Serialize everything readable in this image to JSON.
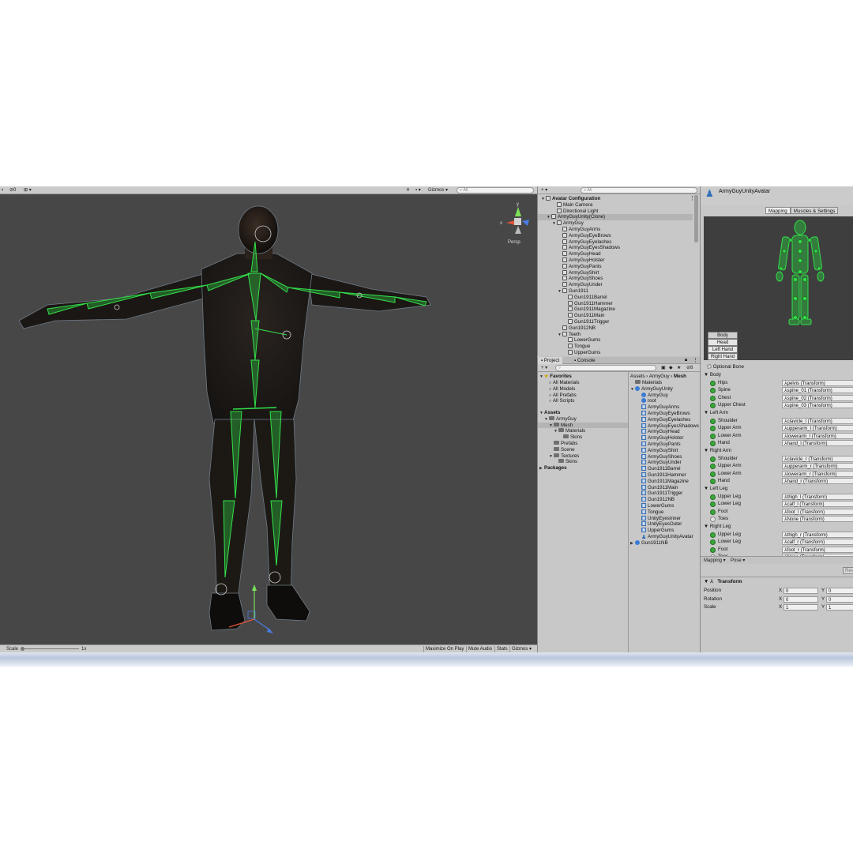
{
  "scene": {
    "toolbar": {
      "stats_left": "0",
      "gizmos": "Gizmos",
      "search_placeholder": "All"
    },
    "persp": "Persp",
    "axis_x": "x",
    "axis_y": "y",
    "gamebar": {
      "scale_label": "Scale",
      "scale_value": "1x",
      "maximize": "Maximize On Play",
      "mute": "Mute Audio",
      "stats": "Stats",
      "gizmos": "Gizmos"
    }
  },
  "hierarchy": {
    "search_placeholder": "All",
    "rows": [
      {
        "label": "Avatar Configuration",
        "indent": 0,
        "arrow": "▼",
        "bold": true
      },
      {
        "label": "Main Camera",
        "indent": 2,
        "arrow": ""
      },
      {
        "label": "Directional Light",
        "indent": 2,
        "arrow": ""
      },
      {
        "label": "ArmyGuyUnity(Clone)",
        "indent": 1,
        "arrow": "▼",
        "selected": true
      },
      {
        "label": "ArmyGuy",
        "indent": 2,
        "arrow": "▼"
      },
      {
        "label": "ArmyGuyArms",
        "indent": 3,
        "arrow": ""
      },
      {
        "label": "ArmyGuyEyeBrows",
        "indent": 3,
        "arrow": ""
      },
      {
        "label": "ArmyGuyEyelashes",
        "indent": 3,
        "arrow": ""
      },
      {
        "label": "ArmyGuyEyesShadows",
        "indent": 3,
        "arrow": ""
      },
      {
        "label": "ArmyGuyHead",
        "indent": 3,
        "arrow": ""
      },
      {
        "label": "ArmyGuyHolster",
        "indent": 3,
        "arrow": ""
      },
      {
        "label": "ArmyGuyPants",
        "indent": 3,
        "arrow": ""
      },
      {
        "label": "ArmyGuyShirt",
        "indent": 3,
        "arrow": ""
      },
      {
        "label": "ArmyGuyShoes",
        "indent": 3,
        "arrow": ""
      },
      {
        "label": "ArmyGuyUnder",
        "indent": 3,
        "arrow": ""
      },
      {
        "label": "Gun1911",
        "indent": 3,
        "arrow": "▼"
      },
      {
        "label": "Gun1911Barrel",
        "indent": 4,
        "arrow": ""
      },
      {
        "label": "Gun1911Hammer",
        "indent": 4,
        "arrow": ""
      },
      {
        "label": "Gun1911Magazine",
        "indent": 4,
        "arrow": ""
      },
      {
        "label": "Gun1911Main",
        "indent": 4,
        "arrow": ""
      },
      {
        "label": "Gun1911Trigger",
        "indent": 4,
        "arrow": ""
      },
      {
        "label": "Gun1912NB",
        "indent": 3,
        "arrow": ""
      },
      {
        "label": "Teeth",
        "indent": 3,
        "arrow": "▼"
      },
      {
        "label": "LowerGums",
        "indent": 4,
        "arrow": ""
      },
      {
        "label": "Tongue",
        "indent": 4,
        "arrow": ""
      },
      {
        "label": "UpperGums",
        "indent": 4,
        "arrow": ""
      }
    ]
  },
  "project": {
    "tab_project": "Project",
    "tab_console": "Console",
    "badge": "8",
    "favorites": "Favorites",
    "fav_items": [
      "All Materials",
      "All Models",
      "All Prefabs",
      "All Scripts"
    ],
    "assets_tree": [
      {
        "label": "Assets",
        "indent": 0,
        "bold": true,
        "arrow": "▼"
      },
      {
        "label": "ArmyGuy",
        "indent": 1,
        "arrow": "▼"
      },
      {
        "label": "Mesh",
        "indent": 2,
        "arrow": "▼",
        "selected": true
      },
      {
        "label": "Materials",
        "indent": 3,
        "arrow": "▼"
      },
      {
        "label": "Skins",
        "indent": 4,
        "arrow": ""
      },
      {
        "label": "Prefabs",
        "indent": 2,
        "arrow": ""
      },
      {
        "label": "Scene",
        "indent": 2,
        "arrow": ""
      },
      {
        "label": "Textures",
        "indent": 2,
        "arrow": "▼"
      },
      {
        "label": "Skins",
        "indent": 3,
        "arrow": ""
      },
      {
        "label": "Packages",
        "indent": 0,
        "bold": true,
        "arrow": "▶"
      }
    ],
    "breadcrumb": [
      "Assets",
      "ArmyGuy",
      "Mesh"
    ],
    "files": [
      {
        "label": "Materials",
        "icon": "folder",
        "indent": 0
      },
      {
        "label": "ArmyGuyUnity",
        "icon": "globe",
        "indent": 0,
        "arrow": "▼"
      },
      {
        "label": "ArmyGuy",
        "icon": "globe",
        "indent": 1
      },
      {
        "label": "root",
        "icon": "globe",
        "indent": 1
      },
      {
        "label": "ArmyGuyArms",
        "icon": "mesh",
        "indent": 1
      },
      {
        "label": "ArmyGuyEyeBrows",
        "icon": "mesh",
        "indent": 1
      },
      {
        "label": "ArmyGuyEyelashes",
        "icon": "mesh",
        "indent": 1
      },
      {
        "label": "ArmyGuyEyesShadows",
        "icon": "mesh",
        "indent": 1
      },
      {
        "label": "ArmyGuyHead",
        "icon": "mesh",
        "indent": 1
      },
      {
        "label": "ArmyGuyHolster",
        "icon": "mesh",
        "indent": 1
      },
      {
        "label": "ArmyGuyPants",
        "icon": "mesh",
        "indent": 1
      },
      {
        "label": "ArmyGuyShirt",
        "icon": "mesh",
        "indent": 1
      },
      {
        "label": "ArmyGuyShoes",
        "icon": "mesh",
        "indent": 1
      },
      {
        "label": "ArmyGuyUnder",
        "icon": "mesh",
        "indent": 1
      },
      {
        "label": "Gun1911Barrel",
        "icon": "mesh",
        "indent": 1
      },
      {
        "label": "Gun1911Hammer",
        "icon": "mesh",
        "indent": 1
      },
      {
        "label": "Gun1911Magazine",
        "icon": "mesh",
        "indent": 1
      },
      {
        "label": "Gun1911Main",
        "icon": "mesh",
        "indent": 1
      },
      {
        "label": "Gun1911Trigger",
        "icon": "mesh",
        "indent": 1
      },
      {
        "label": "Gun1912NB",
        "icon": "mesh",
        "indent": 1
      },
      {
        "label": "LowerGums",
        "icon": "mesh",
        "indent": 1
      },
      {
        "label": "Tongue",
        "icon": "mesh",
        "indent": 1
      },
      {
        "label": "UnityEyesInner",
        "icon": "mesh",
        "indent": 1
      },
      {
        "label": "UnityEyesOuter",
        "icon": "mesh",
        "indent": 1
      },
      {
        "label": "UpperGums",
        "icon": "mesh",
        "indent": 1
      },
      {
        "label": "ArmyGuyUnityAvatar",
        "icon": "avatar",
        "indent": 1
      },
      {
        "label": "Gun1911NB",
        "icon": "globe",
        "indent": 0,
        "arrow": "▶"
      }
    ]
  },
  "inspector": {
    "title": "ArmyGuyUnityAvatar",
    "tab_mapping": "Mapping",
    "tab_muscles": "Muscles & Settings",
    "preview_buttons": [
      "Body",
      "Head",
      "Left Hand",
      "Right Hand"
    ],
    "optional_bone": "Optional Bone",
    "groups": [
      {
        "title": "Body",
        "bones": [
          {
            "label": "Hips",
            "value": "pelvis (Transform)",
            "filled": true
          },
          {
            "label": "Spine",
            "value": "spine_01 (Transform)",
            "filled": true
          },
          {
            "label": "Chest",
            "value": "spine_02 (Transform)",
            "filled": true
          },
          {
            "label": "Upper Chest",
            "value": "spine_03 (Transform)",
            "filled": true
          }
        ]
      },
      {
        "title": "Left Arm",
        "bones": [
          {
            "label": "Shoulder",
            "value": "clavicle_l (Transform)",
            "filled": true
          },
          {
            "label": "Upper Arm",
            "value": "upperarm_l (Transform)",
            "filled": true
          },
          {
            "label": "Lower Arm",
            "value": "lowerarm_l (Transform)",
            "filled": true
          },
          {
            "label": "Hand",
            "value": "hand_l (Transform)",
            "filled": true
          }
        ]
      },
      {
        "title": "Right Arm",
        "bones": [
          {
            "label": "Shoulder",
            "value": "clavicle_r (Transform)",
            "filled": true
          },
          {
            "label": "Upper Arm",
            "value": "upperarm_r (Transform)",
            "filled": true
          },
          {
            "label": "Lower Arm",
            "value": "lowerarm_r (Transform)",
            "filled": true
          },
          {
            "label": "Hand",
            "value": "hand_r (Transform)",
            "filled": true
          }
        ]
      },
      {
        "title": "Left Leg",
        "bones": [
          {
            "label": "Upper Leg",
            "value": "thigh_l (Transform)",
            "filled": true
          },
          {
            "label": "Lower Leg",
            "value": "calf_l (Transform)",
            "filled": true
          },
          {
            "label": "Foot",
            "value": "foot_l (Transform)",
            "filled": true
          },
          {
            "label": "Toes",
            "value": "None (Transform)",
            "filled": false
          }
        ]
      },
      {
        "title": "Right Leg",
        "bones": [
          {
            "label": "Upper Leg",
            "value": "thigh_r (Transform)",
            "filled": true
          },
          {
            "label": "Lower Leg",
            "value": "calf_r (Transform)",
            "filled": true
          },
          {
            "label": "Foot",
            "value": "foot_r (Transform)",
            "filled": true
          },
          {
            "label": "Toes",
            "value": "None (Transform)",
            "filled": false
          }
        ]
      }
    ],
    "mapping_dropdown": "Mapping",
    "pose_dropdown": "Pose",
    "revert": "Rev",
    "transform": {
      "title": "Transform",
      "rows": [
        {
          "label": "Position",
          "x": "0",
          "y": "0"
        },
        {
          "label": "Rotation",
          "x": "0",
          "y": "0"
        },
        {
          "label": "Scale",
          "x": "1",
          "y": "1"
        }
      ],
      "x_label": "X",
      "y_label": "Y"
    }
  },
  "colors": {
    "bone_green": "#33e04a",
    "scene_bg": "#474747",
    "panel_bg": "#c8c8c8"
  }
}
